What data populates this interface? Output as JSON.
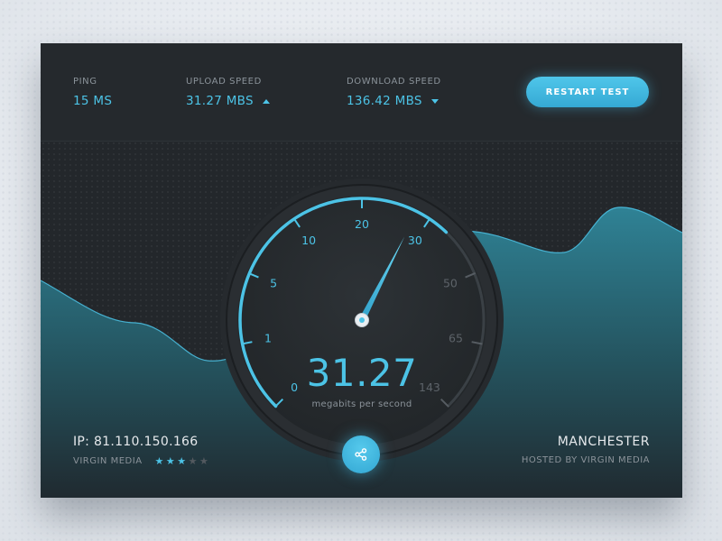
{
  "header": {
    "ping": {
      "label": "PING",
      "value": "15 MS"
    },
    "upload": {
      "label": "UPLOAD SPEED",
      "value": "31.27 MBS",
      "trend": "up"
    },
    "download": {
      "label": "DOWNLOAD SPEED",
      "value": "136.42 MBS",
      "trend": "down"
    },
    "restart_label": "RESTART TEST"
  },
  "gauge": {
    "ticks": [
      "0",
      "1",
      "5",
      "10",
      "20",
      "30",
      "50",
      "65",
      "143"
    ],
    "active_ticks": 6,
    "needle_level": 0.6,
    "reading": "31.27",
    "unit": "megabits per second"
  },
  "footer": {
    "ip": "IP: 81.110.150.166",
    "isp": "VIRGIN MEDIA",
    "rating": 3,
    "rating_max": 5,
    "city": "MANCHESTER",
    "hosted_by": "HOSTED BY VIRGIN MEDIA"
  },
  "icons": {
    "upload_trend": "triangle-up-icon",
    "download_trend": "triangle-down-icon",
    "share": "share-icon",
    "star": "star-icon"
  },
  "colors": {
    "accent": "#4cc3e6",
    "card": "#23272b",
    "wave": "#2f7f91",
    "muted": "#8b939a"
  }
}
